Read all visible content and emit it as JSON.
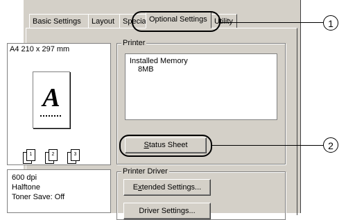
{
  "tabs": [
    {
      "label": "Basic Settings"
    },
    {
      "label": "Layout"
    },
    {
      "label": "Special"
    },
    {
      "label": "Optional Settings"
    },
    {
      "label": "Utility"
    }
  ],
  "preview": {
    "paper_size": "A4 210 x 297 mm",
    "page_letter": "A",
    "copies": [
      "1",
      "2",
      "3"
    ]
  },
  "info": {
    "lines": [
      "600 dpi",
      "Halftone",
      "Toner Save: Off"
    ]
  },
  "printer_group": {
    "label": "Printer",
    "list_items": [
      "Installed Memory",
      "8MB"
    ],
    "status_sheet_prefix": "",
    "status_sheet_mnemonic": "S",
    "status_sheet_rest": "tatus Sheet"
  },
  "driver_group": {
    "label": "Printer Driver",
    "extended_prefix": "E",
    "extended_mnemonic": "x",
    "extended_rest": "tended Settings...",
    "driver_settings_label": "Driver Settings..."
  },
  "callouts": [
    "1",
    "2"
  ]
}
